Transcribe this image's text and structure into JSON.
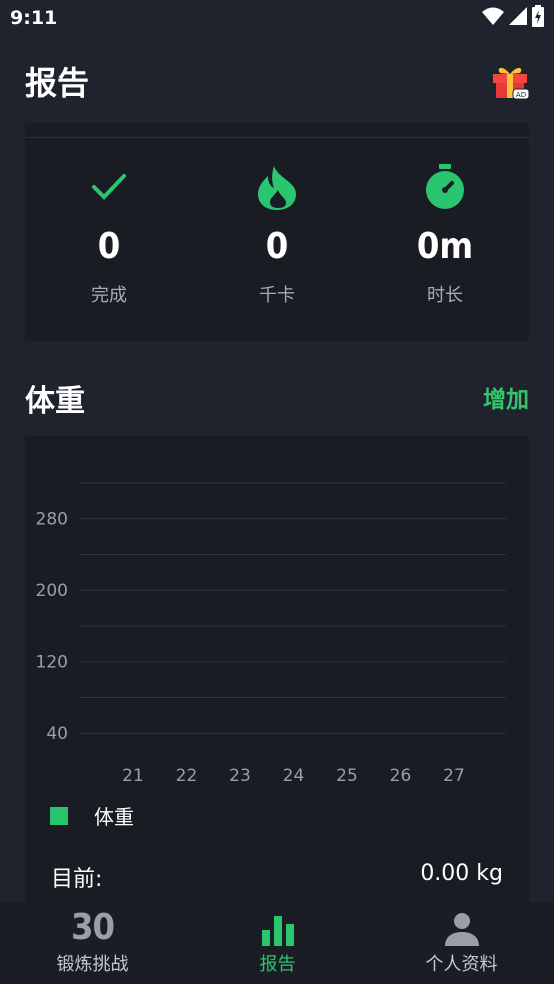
{
  "status_bar": {
    "time": "9:11",
    "icons": [
      "wifi-icon",
      "signal-icon",
      "battery-charging-icon"
    ]
  },
  "header": {
    "title": "报告",
    "gift_badge": "AD"
  },
  "summary": {
    "stats": [
      {
        "icon": "check-icon",
        "value": "0",
        "label": "完成"
      },
      {
        "icon": "flame-icon",
        "value": "0",
        "label": "千卡"
      },
      {
        "icon": "stopwatch-icon",
        "value": "0m",
        "label": "时长"
      }
    ]
  },
  "weight": {
    "title": "体重",
    "add_label": "增加",
    "legend_label": "体重",
    "current_label": "目前:",
    "current_value": "0.00 kg"
  },
  "chart_data": {
    "type": "line",
    "x": [
      21,
      22,
      23,
      24,
      25,
      26,
      27
    ],
    "x_tick_labels": [
      "21",
      "22",
      "23",
      "24",
      "25",
      "26",
      "27"
    ],
    "y_tick_labels": [
      "40",
      "120",
      "200",
      "280"
    ],
    "ylim": [
      10,
      320
    ],
    "series": [
      {
        "name": "体重",
        "values": []
      }
    ],
    "grid": true,
    "legend": "bottom-left"
  },
  "bottom_nav": {
    "items": [
      {
        "badge": "30",
        "label": "锻炼挑战",
        "active": false
      },
      {
        "label": "报告",
        "active": true
      },
      {
        "label": "个人资料",
        "active": false
      }
    ]
  },
  "colors": {
    "accent": "#2ac56f",
    "background": "#1f232d",
    "card": "#1a1c24",
    "muted_text": "#a7abb4"
  }
}
